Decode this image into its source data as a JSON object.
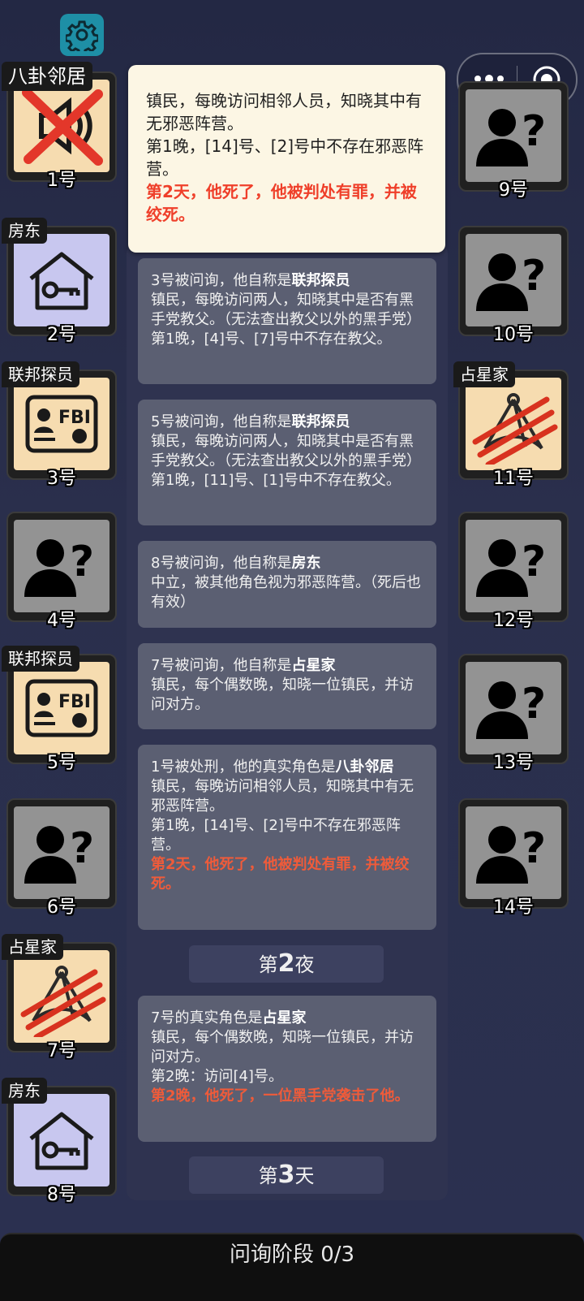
{
  "popup": {
    "line1": "镇民，每晚访问相邻人员，知晓其中有无邪恶阵营。",
    "line2": "第1晚，[14]号、[2]号中不存在邪恶阵营。",
    "death": "第2天，他死了，他被判处有罪，并被绞死。"
  },
  "players": {
    "p1": {
      "num": "1号",
      "tag": "八卦邻居",
      "icon": "speaker-icon",
      "status": "red-x"
    },
    "p2": {
      "num": "2号",
      "tag": "房东",
      "icon": "house-key-icon"
    },
    "p3": {
      "num": "3号",
      "tag": "联邦探员",
      "icon": "fbi-badge-icon"
    },
    "p4": {
      "num": "4号",
      "icon": "unknown-person-icon"
    },
    "p5": {
      "num": "5号",
      "tag": "联邦探员",
      "icon": "fbi-badge-icon"
    },
    "p6": {
      "num": "6号",
      "icon": "unknown-person-icon"
    },
    "p7": {
      "num": "7号",
      "tag": "占星家",
      "icon": "sextant-icon",
      "status": "claw-marks"
    },
    "p8": {
      "num": "8号",
      "tag": "房东",
      "icon": "house-key-icon"
    },
    "p9": {
      "num": "9号",
      "icon": "unknown-person-icon"
    },
    "p10": {
      "num": "10号",
      "icon": "unknown-person-icon"
    },
    "p11": {
      "num": "11号",
      "tag": "占星家",
      "icon": "sextant-icon",
      "status": "claw-marks"
    },
    "p12": {
      "num": "12号",
      "icon": "unknown-person-icon"
    },
    "p13": {
      "num": "13号",
      "icon": "unknown-person-icon"
    },
    "p14": {
      "num": "14号",
      "icon": "unknown-person-icon"
    }
  },
  "log": {
    "e1": {
      "prefix": "3号被问询，他自称是",
      "role": "联邦探员",
      "desc": "镇民，每晚访问两人，知晓其中是否有黑手党教父。（无法查出教父以外的黑手党）",
      "result": "第1晚，[4]号、[7]号中不存在教父。"
    },
    "e2": {
      "prefix": "5号被问询，他自称是",
      "role": "联邦探员",
      "desc": "镇民，每晚访问两人，知晓其中是否有黑手党教父。（无法查出教父以外的黑手党）",
      "result": "第1晚，[11]号、[1]号中不存在教父。"
    },
    "e3": {
      "prefix": "8号被问询，他自称是",
      "role": "房东",
      "desc": "中立，被其他角色视为邪恶阵营。（死后也有效）"
    },
    "e4": {
      "prefix": "7号被问询，他自称是",
      "role": "占星家",
      "desc": "镇民，每个偶数晚，知晓一位镇民，并访问对方。"
    },
    "e5": {
      "prefix": "1号被处刑，他的真实角色是",
      "role": "八卦邻居",
      "desc": "镇民，每晚访问相邻人员，知晓其中有无邪恶阵营。",
      "result": "第1晚，[14]号、[2]号中不存在邪恶阵营。",
      "death": "第2天，他死了，他被判处有罪，并被绞死。"
    },
    "phase1": {
      "pre": "第",
      "n": "2",
      "post": "夜"
    },
    "e6": {
      "prefix": "7号的真实角色是",
      "role": "占星家",
      "desc": "镇民，每个偶数晚，知晓一位镇民，并访问对方。",
      "result": "第2晚：访问[4]号。",
      "death": "第2晚，他死了，一位黑手党袭击了他。"
    },
    "phase2": {
      "pre": "第",
      "n": "3",
      "post": "天"
    }
  },
  "bottom_bar": {
    "label": "问询阶段 0/3"
  },
  "colors": {
    "background": "#262b48",
    "death_text": "#ef5b3a",
    "popup_bg": "#fcf6e4",
    "settings_bg": "#1e8fa6"
  }
}
